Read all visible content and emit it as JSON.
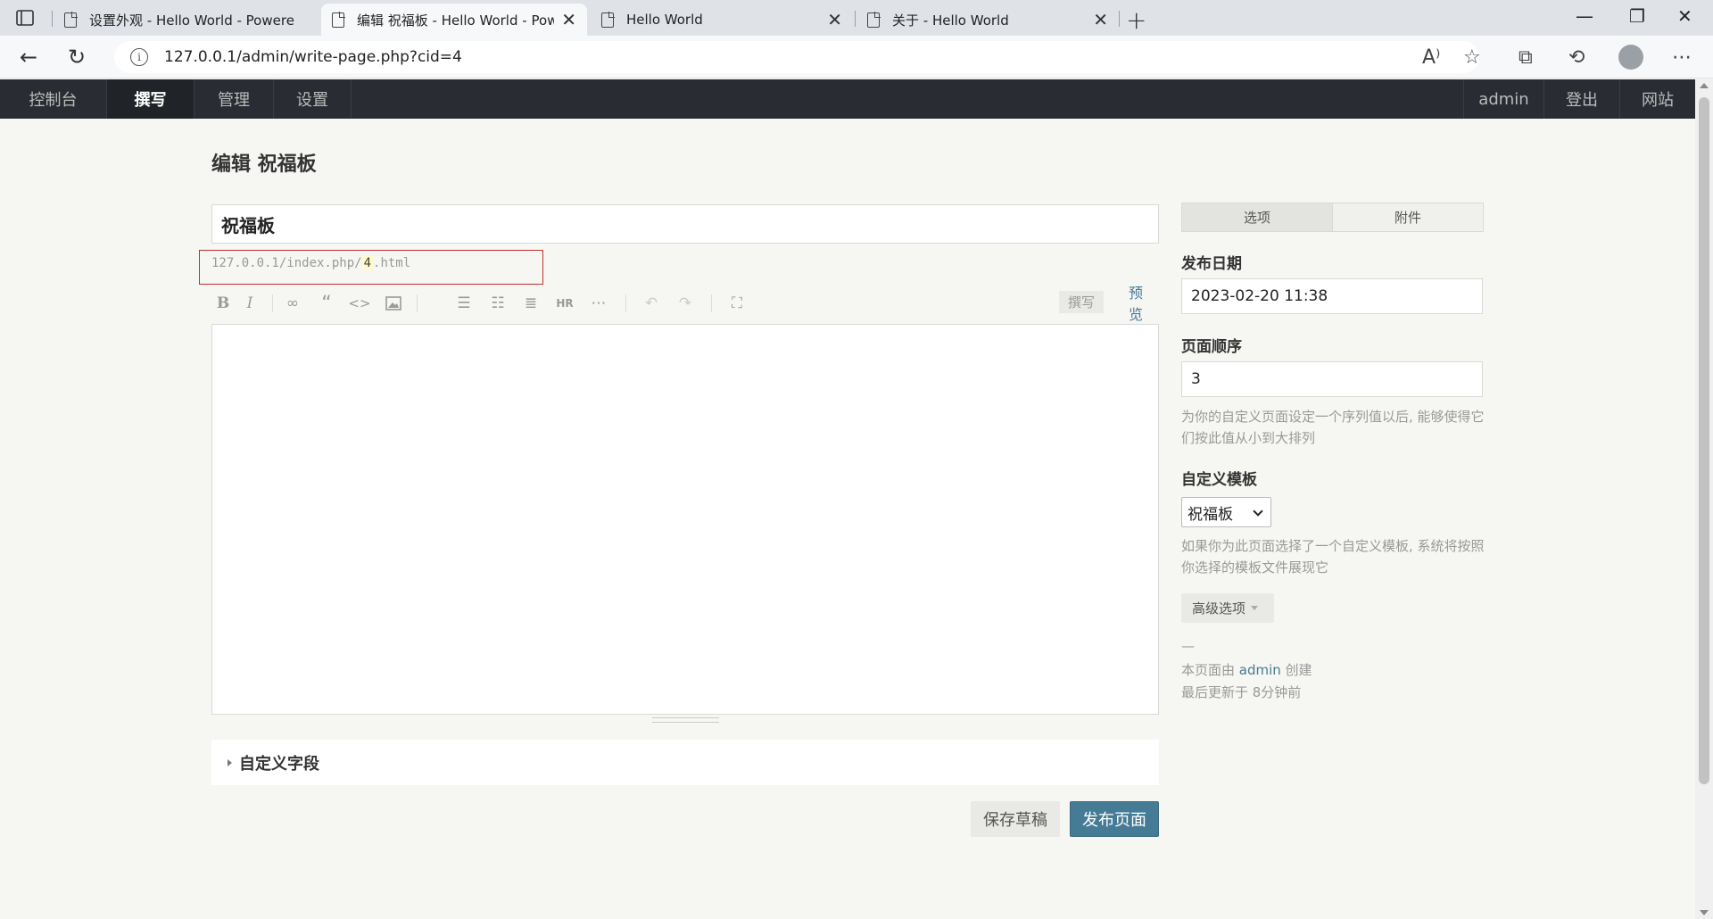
{
  "browser": {
    "tabs": [
      {
        "title": "设置外观 - Hello World - Powere",
        "active": false
      },
      {
        "title": "编辑 祝福板 - Hello World - Pow",
        "active": true
      },
      {
        "title": "Hello World",
        "active": false
      },
      {
        "title": "关于 - Hello World",
        "active": false
      }
    ],
    "url": "127.0.0.1/admin/write-page.php?cid=4"
  },
  "admin_nav": {
    "left": [
      "控制台",
      "撰写",
      "管理",
      "设置"
    ],
    "current": "撰写",
    "right": [
      "admin",
      "登出",
      "网站"
    ]
  },
  "page": {
    "heading": "编辑 祝福板",
    "title_value": "祝福板",
    "slug_prefix": "127.0.0.1/index.php/",
    "slug_value": "4",
    "slug_suffix": ".html",
    "editor_content": ""
  },
  "editor_toolbar": {
    "buttons": [
      "bold-icon",
      "italic-icon",
      "link-icon",
      "quote-icon",
      "code-icon",
      "image-icon",
      "ordered-list-icon",
      "unordered-list-icon",
      "heading-icon",
      "hr-icon",
      "more-icon",
      "undo-icon",
      "redo-icon",
      "fullscreen-icon"
    ],
    "write_label": "撰写",
    "preview_label": "预览"
  },
  "custom_fields_label": "自定义字段",
  "actions": {
    "save_draft": "保存草稿",
    "publish": "发布页面"
  },
  "sidebar": {
    "tabs": [
      "选项",
      "附件"
    ],
    "publish_date_label": "发布日期",
    "publish_date_value": "2023-02-20 11:38",
    "order_label": "页面顺序",
    "order_value": "3",
    "order_desc": "为你的自定义页面设定一个序列值以后, 能够使得它们按此值从小到大排列",
    "template_label": "自定义模板",
    "template_value": "祝福板",
    "template_desc": "如果你为此页面选择了一个自定义模板, 系统将按照你选择的模板文件展现它",
    "advanced_label": "高级选项",
    "dash": "—",
    "created_prefix": "本页面由 ",
    "created_by": "admin",
    "created_suffix": " 创建",
    "updated": "最后更新于 8分钟前"
  },
  "colors": {
    "admin_nav_bg": "#292d33",
    "accent": "#467b96",
    "highlight_box": "#c23030"
  }
}
